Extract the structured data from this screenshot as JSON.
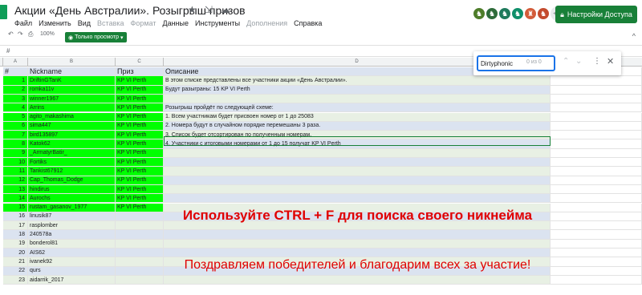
{
  "app": {
    "title": "Акции «День Австралии». Розыгрыш призов",
    "title_icons": [
      "★",
      "⇲",
      "☁"
    ],
    "menu": [
      {
        "label": "Файл",
        "dim": false
      },
      {
        "label": "Изменить",
        "dim": false
      },
      {
        "label": "Вид",
        "dim": false
      },
      {
        "label": "Вставка",
        "dim": true
      },
      {
        "label": "Формат",
        "dim": true
      },
      {
        "label": "Данные",
        "dim": false
      },
      {
        "label": "Инструменты",
        "dim": false
      },
      {
        "label": "Дополнения",
        "dim": true
      },
      {
        "label": "Справка",
        "dim": false
      }
    ],
    "avatars_more": "+41",
    "access_button": "Настройки Доступа",
    "toolbar": {
      "undo": "↶",
      "redo": "↷",
      "print": "⎙",
      "zoom": "100%",
      "view_only": "Только просмотр",
      "collapse": "^"
    },
    "formula": "#"
  },
  "columns": [
    {
      "label": "A"
    },
    {
      "label": "B"
    },
    {
      "label": "C"
    },
    {
      "label": "D"
    }
  ],
  "header": [
    "#",
    "Nickname",
    "Приз",
    "Описание"
  ],
  "rows": [
    {
      "n": "1",
      "nick": "DriftinGTanK",
      "prize": "KP VI Perth",
      "desc": "В этом списке представлены все участники акции «День Австралии»."
    },
    {
      "n": "2",
      "nick": "romka11v",
      "prize": "KP VI Perth",
      "desc": "Будут разыграны: 15 KP VI Perth"
    },
    {
      "n": "3",
      "nick": "winner1967",
      "prize": "KP VI Perth",
      "desc": ""
    },
    {
      "n": "4",
      "nick": "Arrins",
      "prize": "KP VI Perth",
      "desc": "Розыгрыш пройдёт по следующей схеме:"
    },
    {
      "n": "5",
      "nick": "agito_makashima",
      "prize": "KP VI Perth",
      "desc": "1. Всем участникам будет присвоен номер от 1 до 25083"
    },
    {
      "n": "6",
      "nick": "sima447",
      "prize": "KP VI Perth",
      "desc": "2. Номера будут в случайном порядке перемешаны 3 раза."
    },
    {
      "n": "7",
      "nick": "bird135897",
      "prize": "KP VI Perth",
      "desc": "3. Список будет отсортирован по полученным номерам."
    },
    {
      "n": "8",
      "nick": "Katok62",
      "prize": "KP VI Perth",
      "desc": "4. Участники с итоговыми номерами от 1 до 15 получат KP VI Perth"
    },
    {
      "n": "9",
      "nick": "_ArmatyrBatir_",
      "prize": "KP VI Perth",
      "desc": ""
    },
    {
      "n": "10",
      "nick": "Fortiks",
      "prize": "KP VI Perth",
      "desc": ""
    },
    {
      "n": "11",
      "nick": "Tankist67912",
      "prize": "KP VI Perth",
      "desc": ""
    },
    {
      "n": "12",
      "nick": "Cap_Thomas_Dodge",
      "prize": "KP VI Perth",
      "desc": ""
    },
    {
      "n": "13",
      "nick": "hindirus",
      "prize": "KP VI Perth",
      "desc": ""
    },
    {
      "n": "14",
      "nick": "Aurochs",
      "prize": "KP VI Perth",
      "desc": ""
    },
    {
      "n": "15",
      "nick": "rustam_gasanov_1977",
      "prize": "KP VI Perth",
      "desc": ""
    },
    {
      "n": "16",
      "nick": "linusik87",
      "prize": "",
      "desc": ""
    },
    {
      "n": "17",
      "nick": "rasplomber",
      "prize": "",
      "desc": ""
    },
    {
      "n": "18",
      "nick": "240578a",
      "prize": "",
      "desc": ""
    },
    {
      "n": "19",
      "nick": "bonderol81",
      "prize": "",
      "desc": ""
    },
    {
      "n": "20",
      "nick": "AIS62",
      "prize": "",
      "desc": ""
    },
    {
      "n": "21",
      "nick": "ivanek92",
      "prize": "",
      "desc": ""
    },
    {
      "n": "22",
      "nick": "qurs",
      "prize": "",
      "desc": ""
    },
    {
      "n": "23",
      "nick": "aidarrik_2017",
      "prize": "",
      "desc": ""
    }
  ],
  "banners": {
    "ctrl_f": "Используйте CTRL + F для поиска своего никнейма",
    "thanks": "Поздравляем победителей и благодарим всех за участие!"
  },
  "find": {
    "query": "Dirtyphonic",
    "count": "0 из 0",
    "up": "⌃",
    "down": "⌄",
    "more": "⋮",
    "close": "✕"
  },
  "colors": {
    "green": "#00ff00",
    "accent": "#188038",
    "banner_red": "#e00000"
  }
}
